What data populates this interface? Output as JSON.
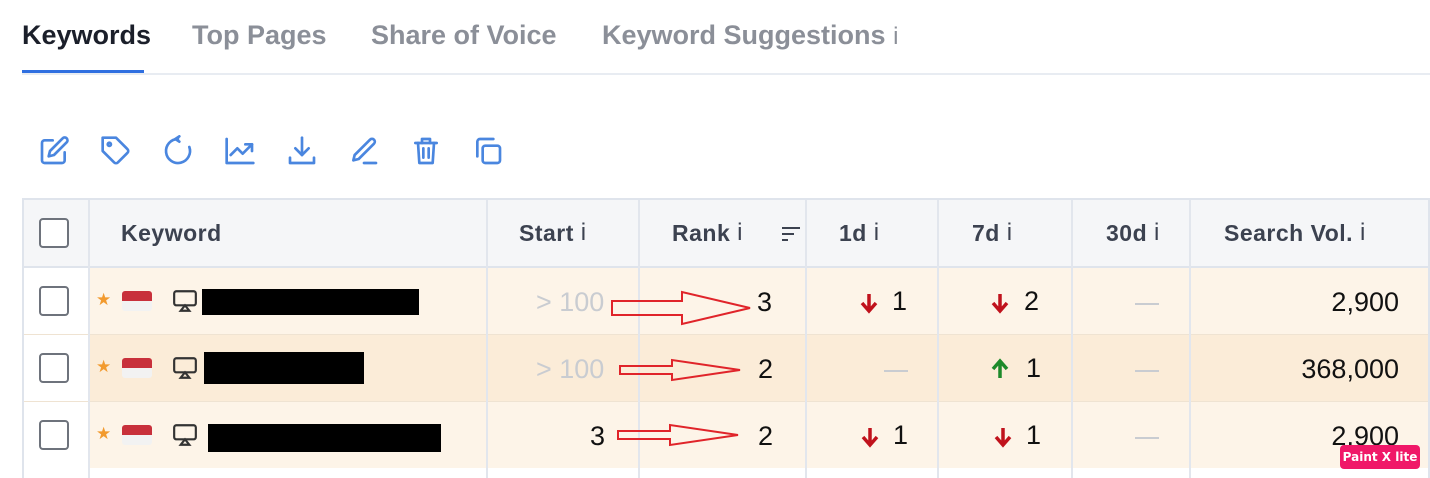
{
  "tabs": [
    {
      "label": "Keywords",
      "active": true
    },
    {
      "label": "Top Pages",
      "active": false
    },
    {
      "label": "Share of Voice",
      "active": false
    },
    {
      "label": "Keyword Suggestions",
      "info": "i",
      "active": false
    }
  ],
  "toolbar": [
    {
      "icon": "edit-icon"
    },
    {
      "icon": "tag-icon"
    },
    {
      "icon": "refresh-icon"
    },
    {
      "icon": "trend-chart-icon"
    },
    {
      "icon": "download-icon"
    },
    {
      "icon": "pencil-icon"
    },
    {
      "icon": "trash-icon"
    },
    {
      "icon": "duplicate-icon"
    }
  ],
  "table": {
    "headers": {
      "keyword": "Keyword",
      "start": "Start",
      "rank": "Rank",
      "d1": "1d",
      "d7": "7d",
      "d30": "30d",
      "volume": "Search Vol.",
      "info": "i"
    },
    "rows": [
      {
        "start": "> 100",
        "start_muted": true,
        "rank": "3",
        "d1": "1",
        "d1_dir": "down",
        "d7": "2",
        "d7_dir": "down",
        "d30": "—",
        "volume": "2,900"
      },
      {
        "start": "> 100",
        "start_muted": true,
        "rank": "2",
        "d1": "—",
        "d1_dir": "none",
        "d7": "1",
        "d7_dir": "up",
        "d30": "—",
        "volume": "368,000"
      },
      {
        "start": "3",
        "start_muted": false,
        "rank": "2",
        "d1": "1",
        "d1_dir": "down",
        "d7": "1",
        "d7_dir": "down",
        "d30": "—",
        "volume": "2,900"
      }
    ]
  },
  "colors": {
    "accent": "#2f6fe0",
    "down": "#c0121c",
    "up": "#1d8a2a",
    "star": "#f29a2e"
  },
  "watermark": "Paint X lite"
}
